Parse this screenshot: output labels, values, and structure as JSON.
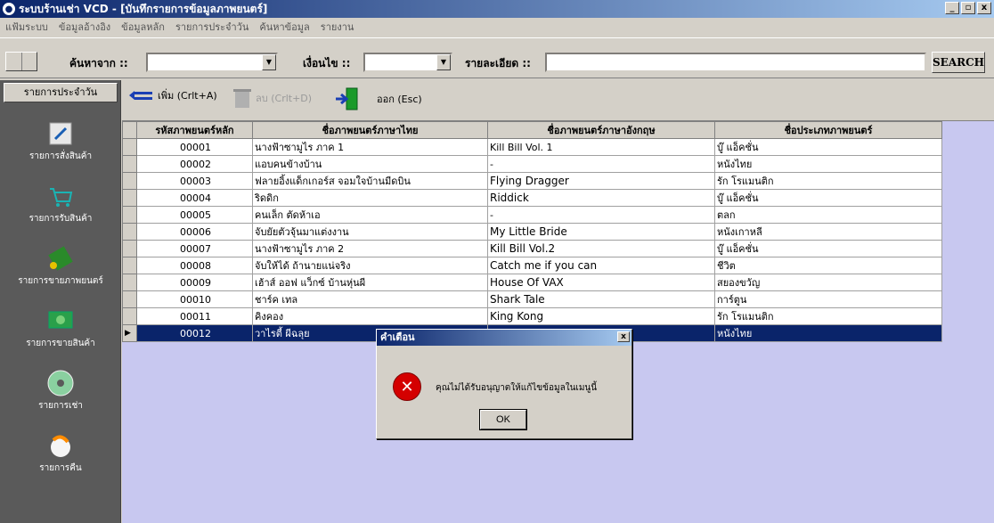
{
  "window": {
    "title": "ระบบร้านเช่า VCD - [บันทึกรายการข้อมูลภาพยนตร์]",
    "min": "_",
    "max": "▫",
    "close": "x"
  },
  "menu": [
    "แฟ้มระบบ",
    "ข้อมูลอ้างอิง",
    "ข้อมูลหลัก",
    "รายการประจำวัน",
    "ค้นหาข้อมูล",
    "รายงาน"
  ],
  "search": {
    "search_from_label": "ค้นหาจาก ::",
    "condition_label": "เงื่อนไข ::",
    "detail_label": "รายละเอียด ::",
    "search_button": "SEARCH",
    "search_from_value": "",
    "condition_value": "",
    "detail_value": ""
  },
  "sidebar": {
    "header": "รายการประจำวัน",
    "items": [
      {
        "label": "รายการสั่งสินค้า",
        "icon": "pencil-icon"
      },
      {
        "label": "รายการรับสินค้า",
        "icon": "cart-icon"
      },
      {
        "label": "รายการขายภาพยนตร์",
        "icon": "film-icon"
      },
      {
        "label": "รายการขายสินค้า",
        "icon": "money-icon"
      },
      {
        "label": "รายการเช่า",
        "icon": "disc-icon"
      },
      {
        "label": "รายการคืน",
        "icon": "return-icon"
      }
    ]
  },
  "actions": {
    "add": "เพิ่ม (Crlt+A)",
    "delete": "ลบ (Crlt+D)",
    "exit": "ออก (Esc)"
  },
  "table": {
    "headers": [
      "รหัสภาพยนตร์หลัก",
      "ชื่อภาพยนตร์ภาษาไทย",
      "ชื่อภาพยนตร์ภาษาอังกฤษ",
      "ชื่อประเภทภาพยนตร์"
    ],
    "rows": [
      [
        "00001",
        "นางฟ้าซามูไร ภาค 1",
        "Kill Bill Vol. 1",
        "บู๊ แอ็คชั่น"
      ],
      [
        "00002",
        "แอบคนข้างบ้าน",
        "-",
        "หนังไทย"
      ],
      [
        "00003",
        "ฟลายอิ้งแด็กเกอร์ส จอมใจบ้านมีดบิน",
        "Flying Dragger",
        "รัก โรแมนติก"
      ],
      [
        "00004",
        "ริดดิก",
        "Riddick",
        "บู๊ แอ็คชั่น"
      ],
      [
        "00005",
        "คนเล็ก ตัดห้าเอ",
        "-",
        "ตลก"
      ],
      [
        "00006",
        "จับยัยตัวจุ้นมาแต่งงาน",
        "My Little Bride",
        "หนังเกาหลี"
      ],
      [
        "00007",
        "นางฟ้าซามูไร ภาค 2",
        "Kill Bill Vol.2",
        "บู๊ แอ็คชั่น"
      ],
      [
        "00008",
        "จับให้ได้ ถ้านายแน่จริง",
        "Catch me if you can",
        "ชีวิต"
      ],
      [
        "00009",
        "เฮ้าส์ ออฟ แว็กซ์ บ้านหุ่นผี",
        "House Of VAX",
        "สยองขวัญ"
      ],
      [
        "00010",
        "ชาร์ค เทล",
        "Shark Tale",
        "การ์ตูน"
      ],
      [
        "00011",
        "คิงคอง",
        "King Kong",
        "รัก โรแมนติก"
      ],
      [
        "00012",
        "วาไรตี้ ผีฉลุย",
        "",
        "หนังไทย"
      ]
    ],
    "selected_row_marker": "▶"
  },
  "dialog": {
    "title": "คำเตือน",
    "close": "x",
    "message": "คุณไม่ได้รับอนุญาตให้แก้ไขข้อมูลในเมนูนี้",
    "ok": "OK",
    "icon_glyph": "✕"
  }
}
